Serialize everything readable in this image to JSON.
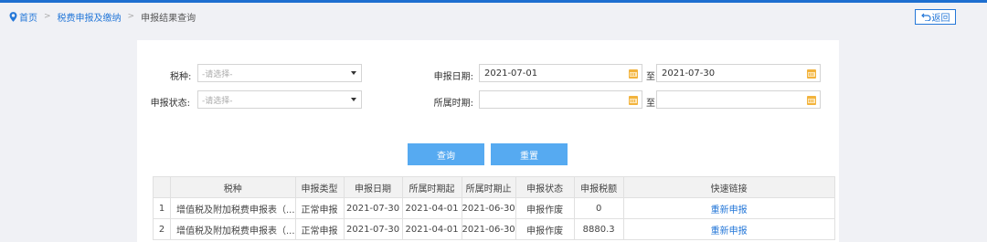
{
  "breadcrumb": {
    "home": "首页",
    "section": "税费申报及缴纳",
    "current": "申报结果查询"
  },
  "header": {
    "back_label": "返回"
  },
  "form": {
    "tax_type_label": "税种:",
    "tax_type_placeholder": "-请选择-",
    "status_label": "申报状态:",
    "status_placeholder": "-请选择-",
    "date_label": "申报日期:",
    "date_from": "2021-07-01",
    "to": "至",
    "date_to": "2021-07-30",
    "period_label": "所属时期:",
    "period_from": "",
    "period_to": ""
  },
  "buttons": {
    "query": "查询",
    "reset": "重置"
  },
  "table": {
    "headers": [
      "",
      "税种",
      "申报类型",
      "申报日期",
      "所属时期起",
      "所属时期止",
      "申报状态",
      "申报税额",
      "快速链接"
    ],
    "rows": [
      [
        "1",
        "增值税及附加税费申报表（...",
        "正常申报",
        "2021-07-30",
        "2021-04-01",
        "2021-06-30",
        "申报作废",
        "0",
        "重新申报"
      ],
      [
        "2",
        "增值税及附加税费申报表（...",
        "正常申报",
        "2021-07-30",
        "2021-04-01",
        "2021-06-30",
        "申报作废",
        "8880.3",
        "重新申报"
      ]
    ]
  },
  "colors": {
    "accent": "#2477d8",
    "button": "#56aaf1",
    "calendar": "#f2b33d"
  },
  "icons": {
    "home": "map-pin-icon",
    "back": "undo-arrow-icon",
    "calendar": "calendar-icon",
    "dropdown": "caret-down-icon"
  }
}
